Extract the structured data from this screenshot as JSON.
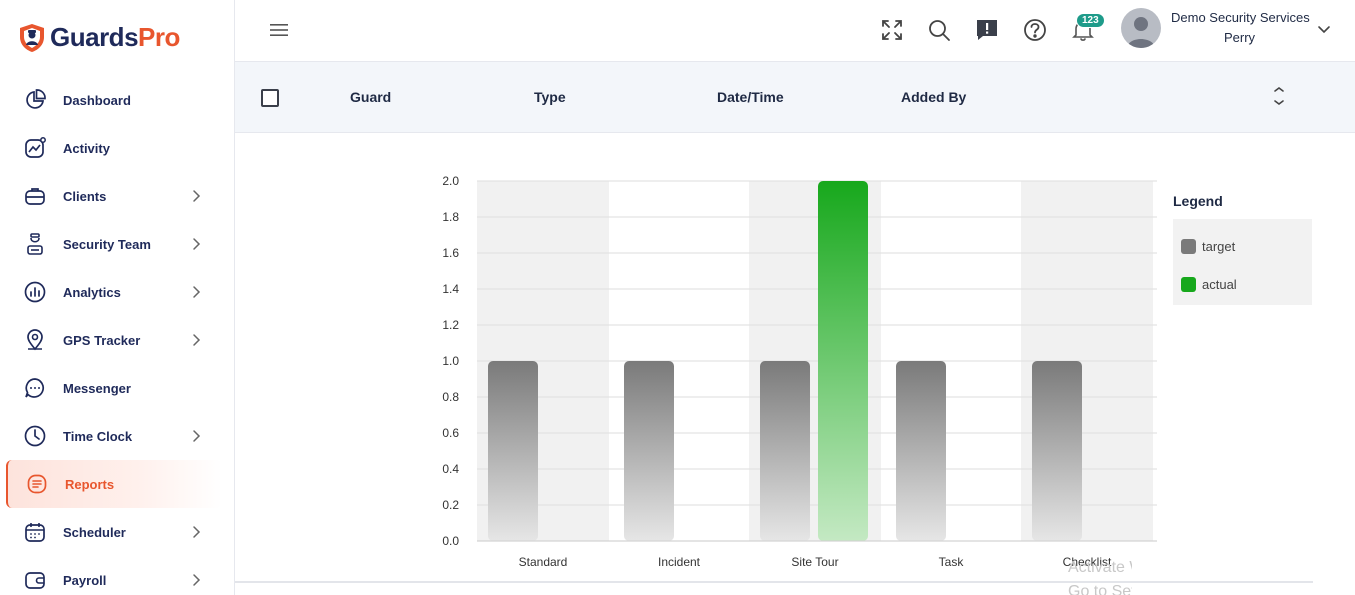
{
  "brand": {
    "name_part1": "Guards",
    "name_part2": "Pro",
    "accent": "#e8562e",
    "navy": "#1f2a5a"
  },
  "sidebar": {
    "items": [
      {
        "label": "Dashboard",
        "icon": "pie-chart-icon",
        "has_submenu": false,
        "active": false
      },
      {
        "label": "Activity",
        "icon": "activity-icon",
        "has_submenu": false,
        "active": false
      },
      {
        "label": "Clients",
        "icon": "briefcase-icon",
        "has_submenu": true,
        "active": false
      },
      {
        "label": "Security Team",
        "icon": "guard-icon",
        "has_submenu": true,
        "active": false
      },
      {
        "label": "Analytics",
        "icon": "analytics-icon",
        "has_submenu": true,
        "active": false
      },
      {
        "label": "GPS Tracker",
        "icon": "map-pin-icon",
        "has_submenu": true,
        "active": false
      },
      {
        "label": "Messenger",
        "icon": "chat-bubble-icon",
        "has_submenu": false,
        "active": false
      },
      {
        "label": "Time Clock",
        "icon": "clock-icon",
        "has_submenu": true,
        "active": false
      },
      {
        "label": "Reports",
        "icon": "reports-icon",
        "has_submenu": false,
        "active": true
      },
      {
        "label": "Scheduler",
        "icon": "calendar-icon",
        "has_submenu": true,
        "active": false
      },
      {
        "label": "Payroll",
        "icon": "wallet-icon",
        "has_submenu": true,
        "active": false
      }
    ]
  },
  "header": {
    "notification_count": "123",
    "user": {
      "company": "Demo Security Services",
      "name": "Perry"
    }
  },
  "table": {
    "columns": [
      "Guard",
      "Type",
      "Date/Time",
      "Added By"
    ]
  },
  "chart_data": {
    "type": "bar",
    "categories": [
      "Standard",
      "Incident",
      "Site Tour",
      "Task",
      "Checklist"
    ],
    "series": [
      {
        "name": "target",
        "values": [
          1,
          1,
          1,
          1,
          1
        ],
        "color": "#7a7a7a"
      },
      {
        "name": "actual",
        "values": [
          0,
          0,
          2,
          0,
          0
        ],
        "color": "#17a81c"
      }
    ],
    "ylim": [
      0,
      2
    ],
    "yticks": [
      "0.0",
      "0.2",
      "0.4",
      "0.6",
      "0.8",
      "1.0",
      "1.2",
      "1.4",
      "1.6",
      "1.8",
      "2.0"
    ],
    "grid": true,
    "legend": {
      "title": "Legend",
      "placement": "right"
    }
  },
  "watermark": {
    "line1": "Activate Windows",
    "line2": "Go to Settings"
  }
}
